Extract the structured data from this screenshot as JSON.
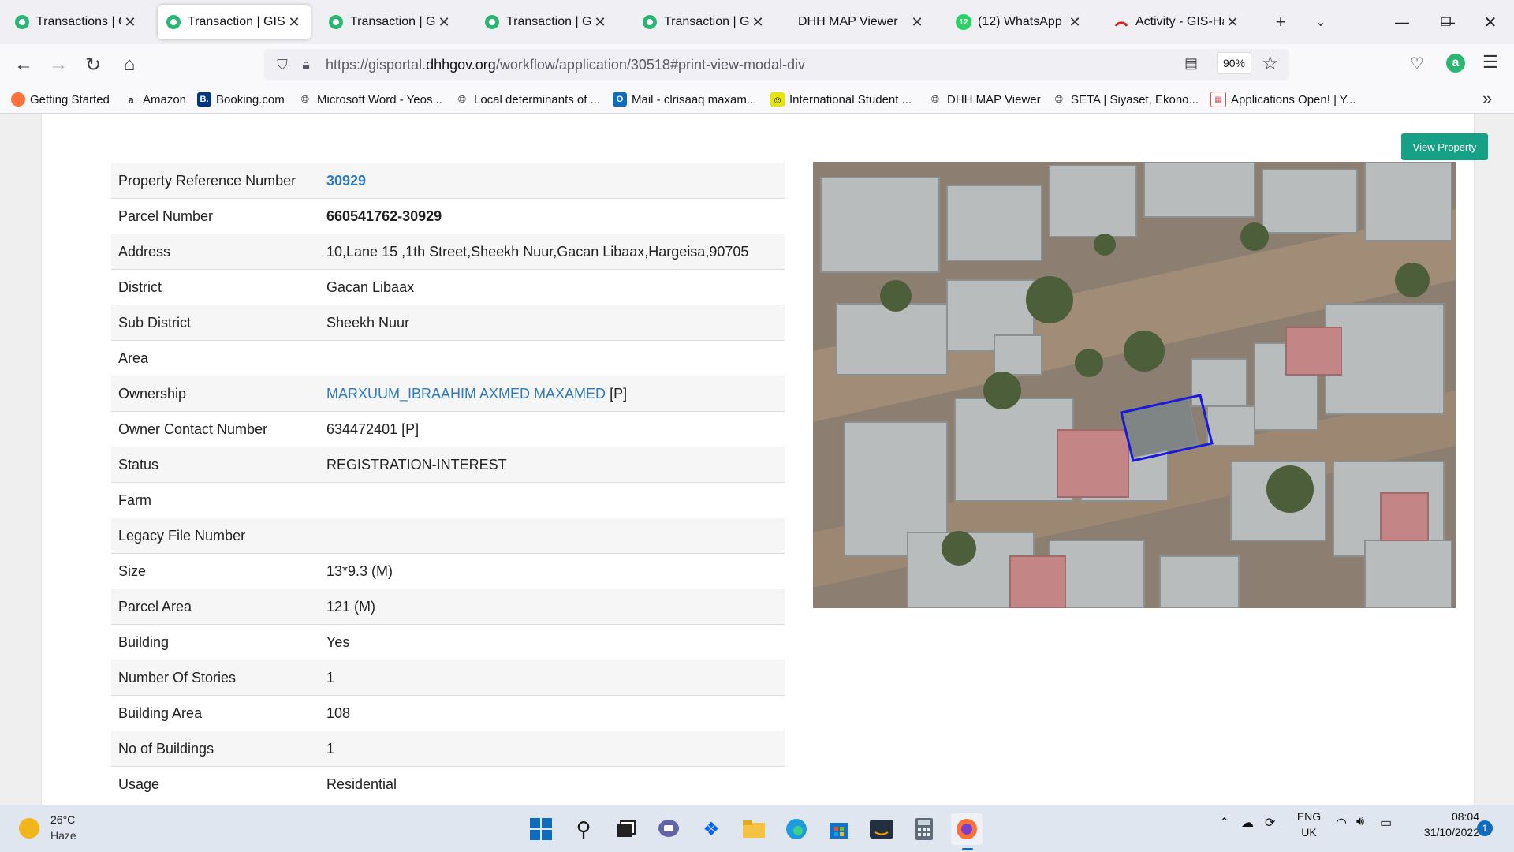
{
  "tabs": [
    {
      "label": "Transactions | GIS Po",
      "close": "✕"
    },
    {
      "label": "Transaction | GIS Po",
      "close": "✕"
    },
    {
      "label": "Transaction | GIS Po",
      "close": "✕"
    },
    {
      "label": "Transaction | GIS Po",
      "close": "✕"
    },
    {
      "label": "Transaction | GIS Po",
      "close": "✕"
    },
    {
      "label": "DHH MAP Viewer",
      "close": "✕"
    },
    {
      "label": "(12) WhatsApp",
      "close": "✕",
      "badge": "12"
    },
    {
      "label": "Activity - GIS-Harge",
      "close": "✕"
    }
  ],
  "url": {
    "prefix": "https://gisportal.",
    "domain": "dhhgov.org",
    "path": "/workflow/application/30518#print-view-modal-div"
  },
  "zoom": "90%",
  "bookmarks": [
    "Getting Started",
    "Amazon",
    "Booking.com",
    "Microsoft Word - Yeos...",
    "Local determinants of ...",
    "Mail - clrisaaq maxam...",
    "International Student ...",
    "DHH MAP Viewer",
    "SETA | Siyaset, Ekono...",
    "Applications Open! | Y..."
  ],
  "view_property_label": "View Property",
  "properties": [
    {
      "label": "Property Reference Number",
      "value": "30929",
      "style": "link bold"
    },
    {
      "label": "Parcel Number",
      "value": "660541762-30929",
      "style": "bold"
    },
    {
      "label": "Address",
      "value": "10,Lane 15 ,1th Street,Sheekh Nuur,Gacan Libaax,Hargeisa,90705"
    },
    {
      "label": "District",
      "value": "Gacan Libaax"
    },
    {
      "label": "Sub District",
      "value": "Sheekh Nuur"
    },
    {
      "label": "Area",
      "value": ""
    },
    {
      "label": "Ownership",
      "value": "MARXUUM_IBRAAHIM AXMED MAXAMED",
      "style": "link",
      "suffix": " [P]"
    },
    {
      "label": "Owner Contact Number",
      "value": "634472401 [P]"
    },
    {
      "label": "Status",
      "value": "REGISTRATION-INTEREST"
    },
    {
      "label": "Farm",
      "value": ""
    },
    {
      "label": "Legacy File Number",
      "value": ""
    },
    {
      "label": "Size",
      "value": "13*9.3 (M)"
    },
    {
      "label": "Parcel Area",
      "value": "121 (M)"
    },
    {
      "label": "Building",
      "value": "Yes"
    },
    {
      "label": "Number Of Stories",
      "value": "1"
    },
    {
      "label": "Building Area",
      "value": "108"
    },
    {
      "label": "No of Buildings",
      "value": "1"
    },
    {
      "label": "Usage",
      "value": "Residential"
    }
  ],
  "weather": {
    "temp": "26°C",
    "desc": "Haze"
  },
  "language": {
    "code": "ENG",
    "region": "UK"
  },
  "clock": {
    "time": "08:04",
    "date": "31/10/2022"
  },
  "notifications": "1",
  "colors": {
    "accent": "#16a085",
    "link": "#2f7bbf",
    "parcel_outline": "#1a1adb"
  }
}
